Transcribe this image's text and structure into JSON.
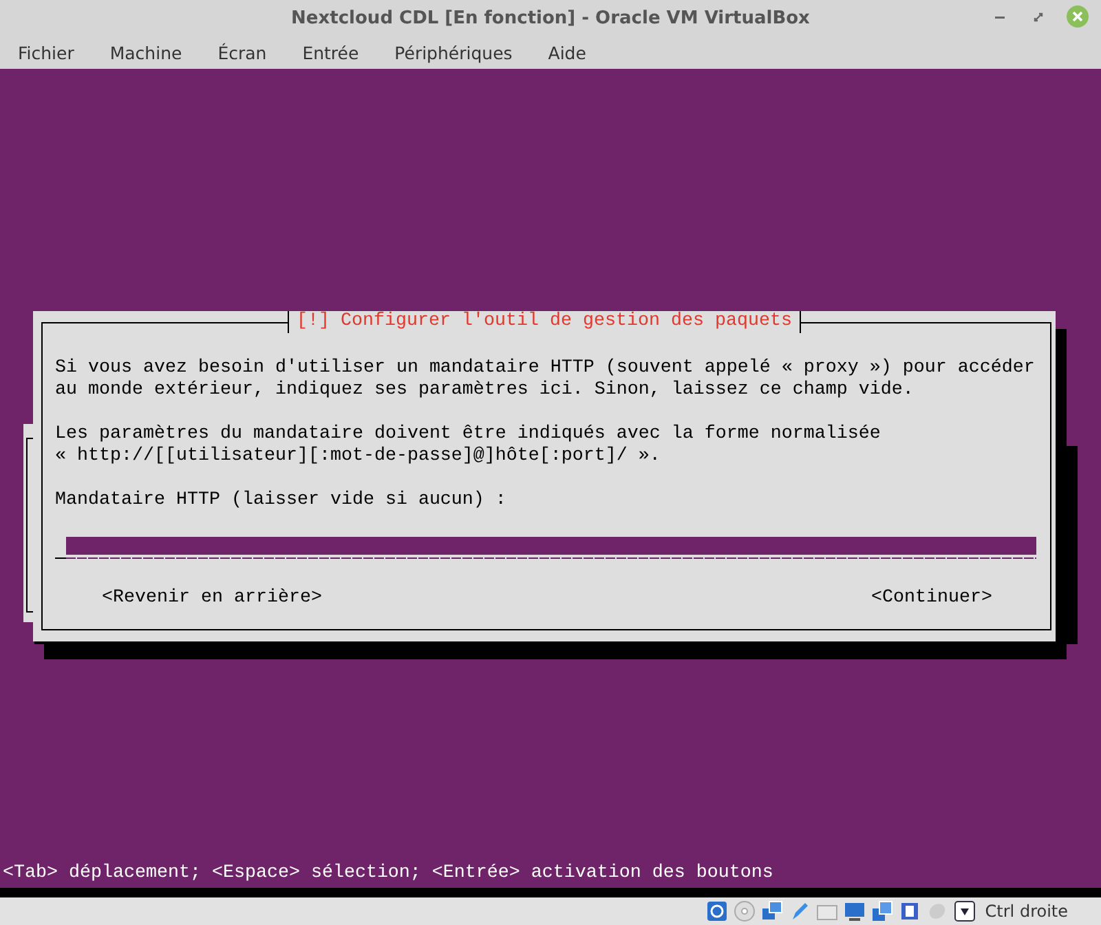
{
  "window": {
    "title": "Nextcloud CDL [En fonction] - Oracle VM VirtualBox"
  },
  "menu": [
    "Fichier",
    "Machine",
    "Écran",
    "Entrée",
    "Périphériques",
    "Aide"
  ],
  "dialog": {
    "title": "[!] Configurer l'outil de gestion des paquets",
    "paragraphs": [
      "Si vous avez besoin d'utiliser un mandataire HTTP (souvent appelé « proxy ») pour accéder\nau monde extérieur, indiquez ses paramètres ici. Sinon, laissez ce champ vide.",
      "Les paramètres du mandataire doivent être indiqués avec la forme normalisée\n« http://[[utilisateur][:mot-de-passe]@]hôte[:port]/ »."
    ],
    "field": {
      "label": "Mandataire HTTP (laisser vide si aucun) :"
    },
    "buttons": [
      {
        "label": "<Revenir en arrière>"
      },
      {
        "label": "<Continuer>"
      }
    ]
  },
  "hint": "<Tab> déplacement; <Espace> sélection; <Entrée> activation des boutons",
  "status_bar": {
    "host_key": "Ctrl droite"
  }
}
